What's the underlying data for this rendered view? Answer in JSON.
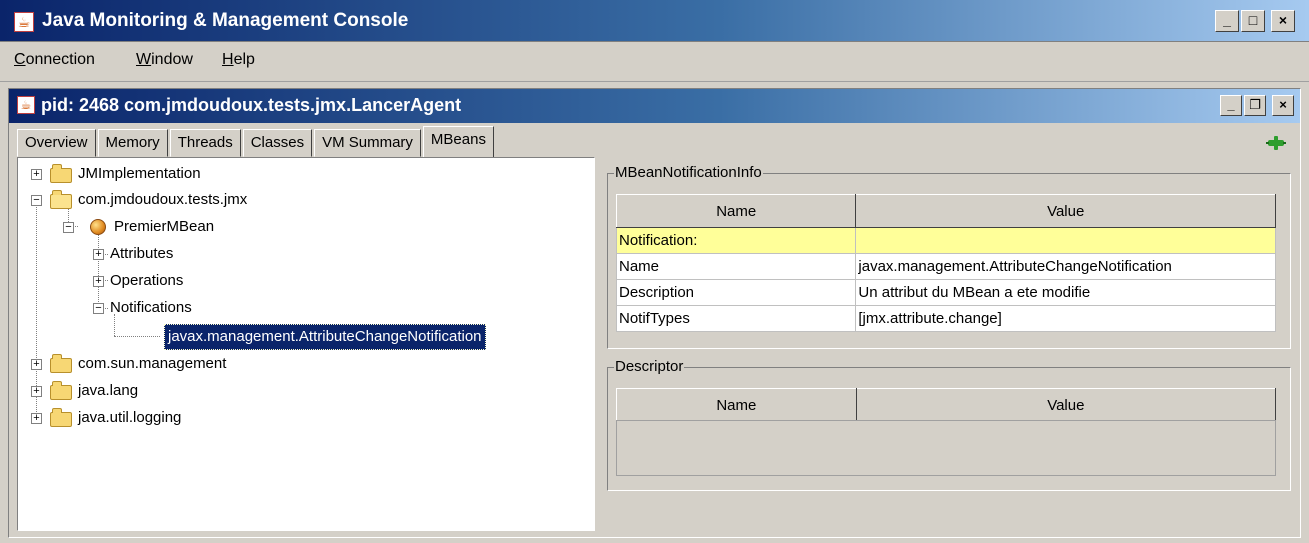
{
  "window": {
    "title": "Java Monitoring & Management Console",
    "app_icon": "java-cup-icon",
    "buttons": {
      "minimize": "_",
      "maximize": "□",
      "close": "×"
    }
  },
  "menu": {
    "connection": "Connection",
    "window": "Window",
    "help": "Help"
  },
  "internal_frame": {
    "title": "pid: 2468 com.jmdoudoux.tests.jmx.LancerAgent",
    "buttons": {
      "minimize": "_",
      "restore": "❐",
      "close": "×"
    }
  },
  "tabs": [
    {
      "label": "Overview"
    },
    {
      "label": "Memory"
    },
    {
      "label": "Threads"
    },
    {
      "label": "Classes"
    },
    {
      "label": "VM Summary"
    },
    {
      "label": "MBeans"
    }
  ],
  "active_tab": "MBeans",
  "tree": {
    "jmimplementation": "JMImplementation",
    "com_jmdoudoux": "com.jmdoudoux.tests.jmx",
    "premier_mbean": "PremierMBean",
    "attributes": "Attributes",
    "operations": "Operations",
    "notifications": "Notifications",
    "selected_notification": "javax.management.AttributeChangeNotification",
    "com_sun_management": "com.sun.management",
    "java_lang": "java.lang",
    "java_util_logging": "java.util.logging",
    "expand_symbol": "+",
    "collapse_symbol": "−"
  },
  "notification_info": {
    "legend": "MBeanNotificationInfo",
    "headers": {
      "name": "Name",
      "value": "Value"
    },
    "rows": [
      {
        "name": "Notification:",
        "value": ""
      },
      {
        "name": "Name",
        "value": "javax.management.AttributeChangeNotification"
      },
      {
        "name": "Description",
        "value": "Un attribut du MBean a ete modifie"
      },
      {
        "name": "NotifTypes",
        "value": "[jmx.attribute.change]"
      }
    ]
  },
  "descriptor": {
    "legend": "Descriptor",
    "headers": {
      "name": "Name",
      "value": "Value"
    }
  },
  "colors": {
    "title_gradient_start": "#0a246a",
    "title_gradient_end": "#a6caf0",
    "highlight_row": "#ffff99",
    "selection": "#0a246a"
  }
}
